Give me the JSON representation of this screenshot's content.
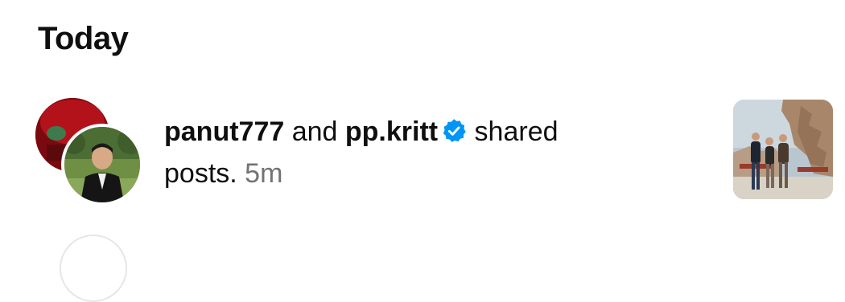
{
  "section": {
    "title": "Today"
  },
  "notification": {
    "user1": "panut777",
    "connector": " and ",
    "user2": "pp.kritt",
    "user2_verified": true,
    "action_line1": " shared",
    "action_line2": "posts. ",
    "time": "5m",
    "verified_icon": "verified-badge-icon",
    "colors": {
      "verified": "#0095f6",
      "time": "#737373",
      "text": "#0f0f0f"
    }
  }
}
